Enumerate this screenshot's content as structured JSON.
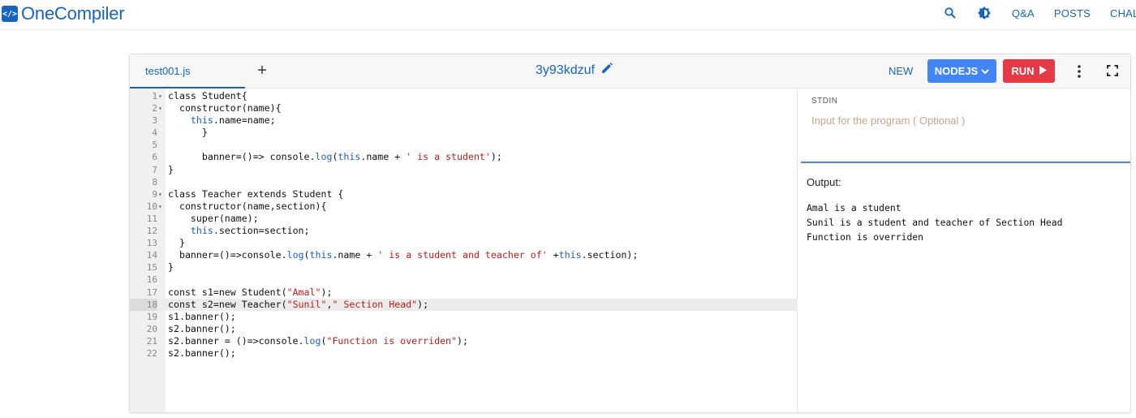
{
  "brand": {
    "logo": "</>",
    "name": "OneCompiler"
  },
  "nav": {
    "icons": [
      "search-icon",
      "theme-toggle-icon"
    ],
    "links": [
      "Q&A",
      "POSTS",
      "CHALLENGES"
    ]
  },
  "toolbar": {
    "file_tab": "test001.js",
    "add_tab": "+",
    "file_id": "3y93kdzuf",
    "new_label": "NEW",
    "language_label": "NODEJS",
    "run_label": "RUN"
  },
  "colors": {
    "accent": "#1565c0",
    "language_button": "#4285f4",
    "run_button": "#e53945",
    "keyword": "#1a5ec9",
    "string": "#c41a16"
  },
  "editor": {
    "active_line": 18,
    "lines": [
      {
        "n": "1",
        "fold": "▾",
        "text": "class Student{"
      },
      {
        "n": "2",
        "fold": "▾",
        "text": "  constructor(name){"
      },
      {
        "n": "3",
        "fold": "",
        "text": "    this.name=name;"
      },
      {
        "n": "4",
        "fold": "",
        "text": "      }"
      },
      {
        "n": "5",
        "fold": "",
        "text": ""
      },
      {
        "n": "6",
        "fold": "",
        "text": "      banner=()=> console.log(this.name + ' is a student');"
      },
      {
        "n": "7",
        "fold": "",
        "text": "}"
      },
      {
        "n": "8",
        "fold": "",
        "text": ""
      },
      {
        "n": "9",
        "fold": "▾",
        "text": "class Teacher extends Student {"
      },
      {
        "n": "10",
        "fold": "▾",
        "text": "  constructor(name,section){"
      },
      {
        "n": "11",
        "fold": "",
        "text": "    super(name);"
      },
      {
        "n": "12",
        "fold": "",
        "text": "    this.section=section;"
      },
      {
        "n": "13",
        "fold": "",
        "text": "  }"
      },
      {
        "n": "14",
        "fold": "",
        "text": "  banner=()=>console.log(this.name + ' is a student and teacher of' +this.section);"
      },
      {
        "n": "15",
        "fold": "",
        "text": "}"
      },
      {
        "n": "16",
        "fold": "",
        "text": ""
      },
      {
        "n": "17",
        "fold": "",
        "text": "const s1=new Student(\"Amal\");"
      },
      {
        "n": "18",
        "fold": "",
        "text": "const s2=new Teacher(\"Sunil\",\" Section Head\");"
      },
      {
        "n": "19",
        "fold": "",
        "text": "s1.banner();"
      },
      {
        "n": "20",
        "fold": "",
        "text": "s2.banner();"
      },
      {
        "n": "21",
        "fold": "",
        "text": "s2.banner = ()=>console.log(\"Function is overriden\");"
      },
      {
        "n": "22",
        "fold": "",
        "text": "s2.banner();"
      }
    ]
  },
  "stdin": {
    "label": "STDIN",
    "placeholder": "Input for the program ( Optional )"
  },
  "output": {
    "label": "Output:",
    "text": "Amal is a student\nSunil is a student and teacher of Section Head\nFunction is overriden"
  }
}
